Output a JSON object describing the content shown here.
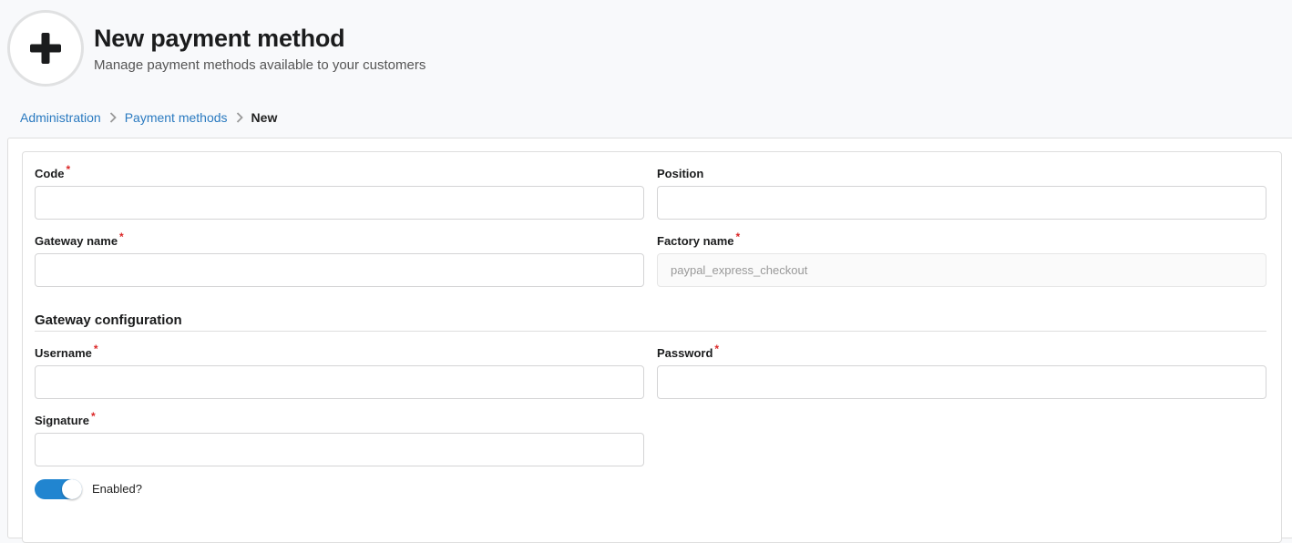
{
  "header": {
    "title": "New payment method",
    "subtitle": "Manage payment methods available to your customers",
    "icon": "plus-icon"
  },
  "breadcrumb": {
    "items": [
      {
        "label": "Administration"
      },
      {
        "label": "Payment methods"
      }
    ],
    "active": "New"
  },
  "form": {
    "code": {
      "label": "Code",
      "required": "*",
      "value": ""
    },
    "position": {
      "label": "Position",
      "value": ""
    },
    "gateway_name": {
      "label": "Gateway name",
      "required": "*",
      "value": ""
    },
    "factory_name": {
      "label": "Factory name",
      "required": "*",
      "value": "paypal_express_checkout"
    },
    "gateway_configuration": {
      "title": "Gateway configuration",
      "username": {
        "label": "Username",
        "required": "*",
        "value": ""
      },
      "password": {
        "label": "Password",
        "required": "*",
        "value": ""
      },
      "signature": {
        "label": "Signature",
        "required": "*",
        "value": ""
      }
    },
    "enabled": {
      "label": "Enabled?",
      "checked": true
    }
  },
  "colors": {
    "link": "#2a7ac0",
    "required": "#db2828",
    "toggle_on": "#2185d0"
  }
}
